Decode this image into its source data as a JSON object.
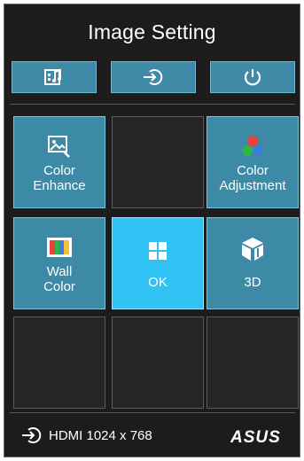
{
  "header": {
    "title": "Image Setting"
  },
  "top_buttons": [
    {
      "name": "image-setting-icon"
    },
    {
      "name": "input-source-icon"
    },
    {
      "name": "power-icon"
    }
  ],
  "tiles": {
    "color_enhance": {
      "label": "Color\nEnhance",
      "icon": "image-enhance-icon"
    },
    "color_adjustment": {
      "label": "Color\nAdjustment",
      "icon": "rgb-circles-icon"
    },
    "wall_color": {
      "label": "Wall\nColor",
      "icon": "color-bars-icon"
    },
    "ok": {
      "label": "OK",
      "icon": "grid-icon"
    },
    "three_d": {
      "label": "3D",
      "icon": "cube-3d-icon"
    }
  },
  "status": {
    "source": "HDMI 1024 x 768",
    "brand": "ASUS"
  },
  "colors": {
    "accent": "#3f8aa6",
    "selected": "#2fc2f2",
    "background": "#1c1c1c"
  }
}
